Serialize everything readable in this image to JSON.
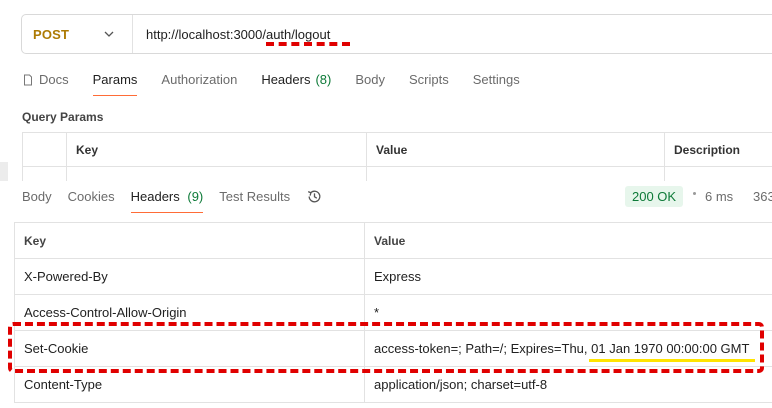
{
  "request": {
    "method": "POST",
    "url": "http://localhost:3000/auth/logout"
  },
  "request_tabs": [
    {
      "label": "Docs"
    },
    {
      "label": "Params"
    },
    {
      "label": "Authorization"
    },
    {
      "label": "Headers",
      "count": "(8)"
    },
    {
      "label": "Body"
    },
    {
      "label": "Scripts"
    },
    {
      "label": "Settings"
    }
  ],
  "query_params": {
    "title": "Query Params",
    "columns": [
      "Key",
      "Value",
      "Description"
    ]
  },
  "response_tabs": [
    {
      "label": "Body"
    },
    {
      "label": "Cookies"
    },
    {
      "label": "Headers",
      "count": "(9)"
    },
    {
      "label": "Test Results"
    }
  ],
  "response_meta": {
    "status": "200 OK",
    "time": "6 ms",
    "size": "363"
  },
  "response_headers": {
    "columns": [
      "Key",
      "Value"
    ],
    "rows": [
      {
        "key": "X-Powered-By",
        "value": "Express"
      },
      {
        "key": "Access-Control-Allow-Origin",
        "value": "*"
      },
      {
        "key": "Set-Cookie",
        "value_prefix": "access-token=; Path=/; Expires=Thu, ",
        "value_highlight": "01 Jan 1970 00:00:00 GMT"
      },
      {
        "key": "Content-Type",
        "value": "application/json; charset=utf-8"
      }
    ]
  },
  "colors": {
    "method": "#ad7a03",
    "accent_tab": "#ff6c37",
    "count_green": "#0d7a38",
    "status_bg": "#e7f6ec",
    "annotation_red": "#e00000",
    "highlight_yellow": "#ffe400"
  }
}
